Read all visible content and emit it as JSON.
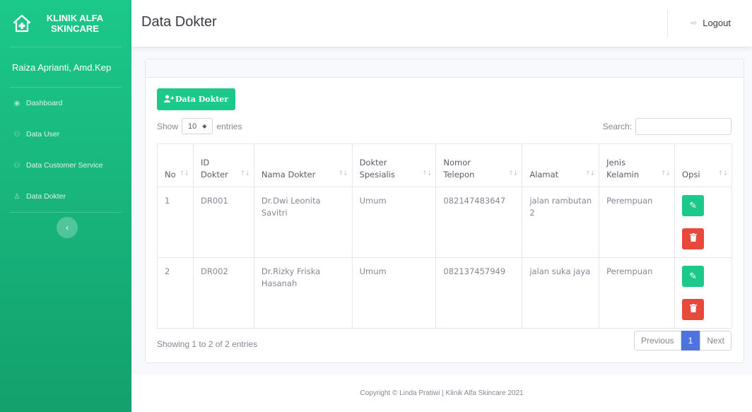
{
  "brand": {
    "line1": "KLINIK ALFA",
    "line2": "SKINCARE",
    "icon": "clinic-plus-icon"
  },
  "sidebar": {
    "user": "Raiza Aprianti, Amd.Kep",
    "items": [
      {
        "label": "Dashboard",
        "icon": "palette-icon"
      },
      {
        "label": "Data User",
        "icon": "users-icon"
      },
      {
        "label": "Data Customer Service",
        "icon": "users-icon"
      },
      {
        "label": "Data Dokter",
        "icon": "user-icon"
      }
    ],
    "toggle_glyph": "‹"
  },
  "topbar": {
    "title": "Data Dokter",
    "logout": "Logout",
    "logout_glyph": "⇨"
  },
  "card": {
    "add_button": "Data Dokter",
    "add_glyph": "👤+",
    "show_label": "Show",
    "entries_value": "10",
    "entries_label": "entries",
    "search_label": "Search:",
    "search_value": ""
  },
  "table": {
    "headers": [
      {
        "line1": "No",
        "line2": ""
      },
      {
        "line1": "ID",
        "line2": "Dokter"
      },
      {
        "line1": "Nama Dokter",
        "line2": ""
      },
      {
        "line1": "Dokter",
        "line2": "Spesialis"
      },
      {
        "line1": "Nomor",
        "line2": "Telepon"
      },
      {
        "line1": "Alamat",
        "line2": ""
      },
      {
        "line1": "Jenis",
        "line2": "Kelamin"
      },
      {
        "line1": "Opsi",
        "line2": ""
      }
    ],
    "rows": [
      {
        "no": "1",
        "id": "DR001",
        "nama": "Dr.Dwi Leonita Savitri",
        "spesialis": "Umum",
        "telepon": "082147483647",
        "alamat": "jalan rambutan 2",
        "kelamin": "Perempuan"
      },
      {
        "no": "2",
        "id": "DR002",
        "nama": "Dr.Rizky Friska Hasanah",
        "spesialis": "Umum",
        "telepon": "082137457949",
        "alamat": "jalan suka jaya",
        "kelamin": "Perempuan"
      }
    ],
    "sort_glyph": "↑↓",
    "edit_glyph": "✎",
    "delete_glyph": "🗑"
  },
  "pagination": {
    "info": "Showing 1 to 2 of 2 entries",
    "previous": "Previous",
    "current": "1",
    "next": "Next"
  },
  "footer": {
    "text": "Copyright © Linda Pratiwi | Klinik Alfa Skincare 2021"
  },
  "colors": {
    "primary": "#1cc88a",
    "danger": "#e74a3b",
    "page_active": "#4e73df"
  }
}
